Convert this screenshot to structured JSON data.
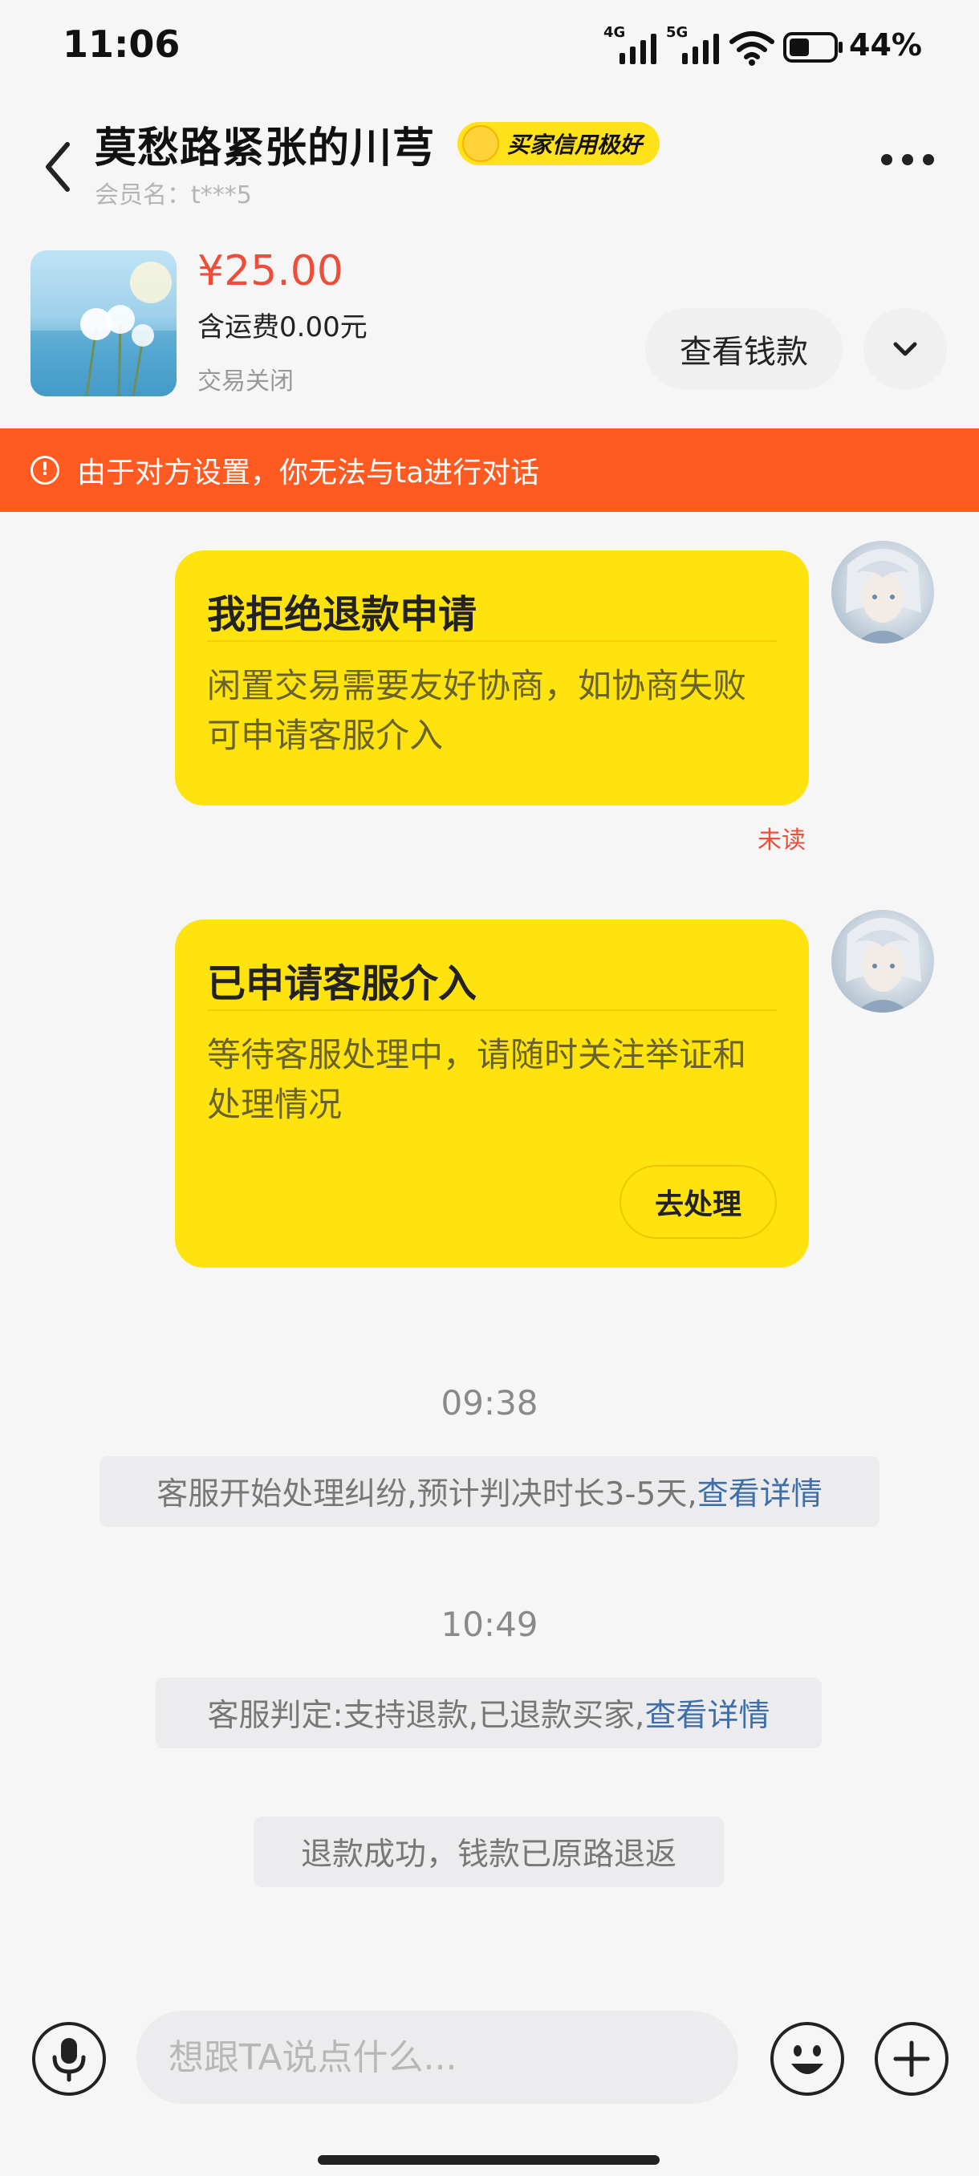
{
  "status_bar": {
    "time": "11:06",
    "network1": "4G",
    "network2": "5G",
    "battery": "44%",
    "icons": [
      "signal-4g-icon",
      "signal-5g-icon",
      "wifi-icon",
      "battery-icon"
    ]
  },
  "header": {
    "title": "莫愁路紧张的川芎",
    "badge": "买家信用极好",
    "member_line": "会员名：t***5"
  },
  "order": {
    "price": "¥25.00",
    "shipping": "含运费0.00元",
    "status": "交易关闭",
    "view_money_label": "查看钱款"
  },
  "warning": {
    "text": "由于对方设置，你无法与ta进行对话",
    "color": "#ff5a22"
  },
  "messages": {
    "card1": {
      "title": "我拒绝退款申请",
      "body": "闲置交易需要友好协商，如协商失败可申请客服介入",
      "status": "未读"
    },
    "card2": {
      "title": "已申请客服介入",
      "body": "等待客服处理中，请随时关注举证和处理情况",
      "button": "去处理"
    }
  },
  "system": {
    "time1": "09:38",
    "msg1_text": "客服开始处理纠纷,预计判决时长3-5天,",
    "msg1_link": "查看详情",
    "time2": "10:49",
    "msg2_text": "客服判定:支持退款,已退款买家,",
    "msg2_link": "查看详情",
    "msg3_text": "退款成功，钱款已原路退返"
  },
  "input": {
    "placeholder": "想跟TA说点什么..."
  },
  "colors": {
    "accent_yellow": "#ffe30f",
    "price_red": "#ee4d3a",
    "link_blue": "#3f6fa8"
  }
}
